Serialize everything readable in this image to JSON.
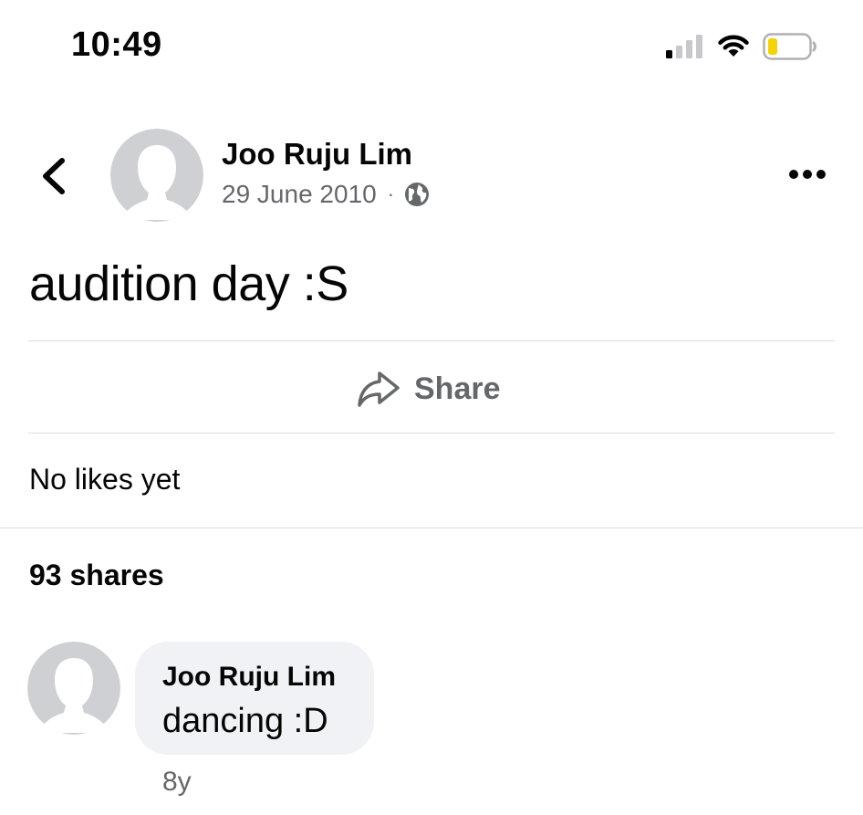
{
  "status_bar": {
    "time": "10:49",
    "icons": [
      "cellular-signal-icon",
      "wifi-icon",
      "battery-low-icon"
    ],
    "battery_color": "#f5d300"
  },
  "header": {
    "back_icon": "chevron-left-icon",
    "author_name": "Joo Ruju Lim",
    "date": "29 June 2010",
    "separator": "·",
    "privacy_icon": "globe-icon",
    "more_icon": "ellipsis-icon"
  },
  "post": {
    "text": "audition day :S"
  },
  "actions": {
    "share_label": "Share",
    "share_icon": "share-arrow-icon"
  },
  "reactions": {
    "likes_text": "No likes yet"
  },
  "shares": {
    "count_text": "93 shares"
  },
  "comments": [
    {
      "author": "Joo Ruju Lim",
      "text": "dancing :D",
      "time": "8y"
    }
  ],
  "colors": {
    "primary_text": "#050505",
    "secondary_text": "#65676b",
    "divider": "#dadde1",
    "bubble_bg": "#f0f2f5",
    "avatar_bg": "#ced0d4"
  }
}
